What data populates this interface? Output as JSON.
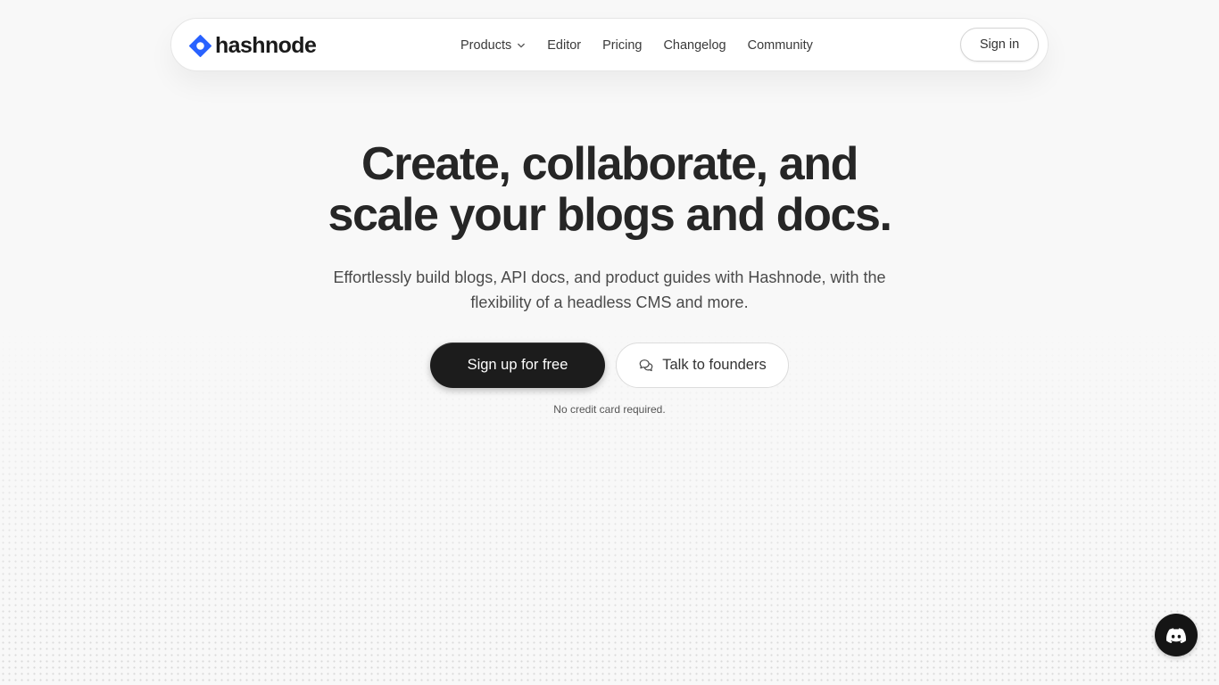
{
  "colors": {
    "brand": "#2962FF",
    "text_primary": "#262626",
    "button_dark": "#1c1c1c",
    "background": "#f8f8f8"
  },
  "header": {
    "logo_text": "hashnode",
    "logo_icon": "hashnode-logo-icon",
    "nav": [
      {
        "label": "Products",
        "has_dropdown": true
      },
      {
        "label": "Editor"
      },
      {
        "label": "Pricing"
      },
      {
        "label": "Changelog"
      },
      {
        "label": "Community"
      }
    ],
    "signin_label": "Sign in"
  },
  "hero": {
    "title_line1": "Create, collaborate, and",
    "title_line2": "scale your blogs and docs.",
    "subtitle_line1": "Effortlessly build blogs, API docs, and product guides with Hashnode, with the",
    "subtitle_line2": "flexibility of a headless CMS and more.",
    "primary_cta": "Sign up for free",
    "secondary_cta": "Talk to founders",
    "secondary_cta_icon": "chat-bubbles-icon",
    "note": "No credit card required."
  },
  "floating": {
    "discord_icon": "discord-icon"
  }
}
